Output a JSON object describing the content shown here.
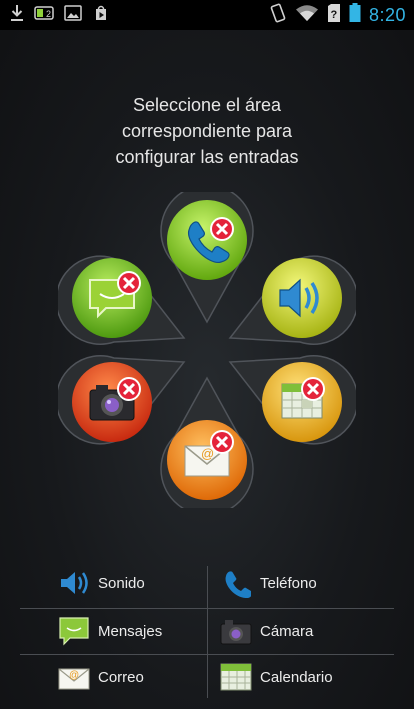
{
  "status_bar": {
    "time": "8:20",
    "left_icons": [
      "download-icon",
      "battery-saver-icon",
      "gallery-icon",
      "play-store-icon"
    ],
    "right_icons": [
      "vibrate-icon",
      "wifi-icon",
      "sim-icon",
      "battery-icon"
    ],
    "clock_color": "#33b5e5"
  },
  "instruction": {
    "line1": "Seleccione el área",
    "line2": "correspondiente para",
    "line3": "configurar las entradas"
  },
  "petals": [
    {
      "id": "telefono",
      "icon": "phone-icon",
      "color": "#7fc41c",
      "disabled": true
    },
    {
      "id": "sonido",
      "icon": "speaker-icon",
      "color": "#c4d41a",
      "disabled": false
    },
    {
      "id": "calendario",
      "icon": "calendar-icon",
      "color": "#e8b418",
      "disabled": true
    },
    {
      "id": "correo",
      "icon": "mail-icon",
      "color": "#ef7d12",
      "disabled": true
    },
    {
      "id": "camara",
      "icon": "camera-icon",
      "color": "#e8401a",
      "disabled": true
    },
    {
      "id": "mensajes",
      "icon": "message-icon",
      "color": "#6fb81c",
      "disabled": true
    }
  ],
  "legend": {
    "sonido": "Sonido",
    "telefono": "Teléfono",
    "mensajes": "Mensajes",
    "camara": "Cámara",
    "correo": "Correo",
    "calendario": "Calendario"
  },
  "colors": {
    "background": "#17191c",
    "separator": "#4a4d52",
    "remove_badge": "#e4233a"
  }
}
